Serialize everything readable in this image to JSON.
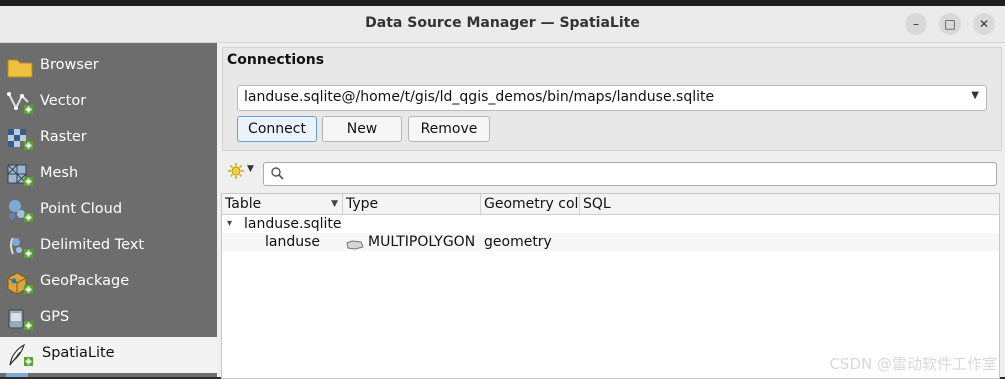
{
  "window": {
    "title": "Data Source Manager — SpatiaLite",
    "minimize_label": "–",
    "maximize_label": "□",
    "close_label": "✕"
  },
  "sidebar": {
    "items": [
      {
        "label": "Browser",
        "icon": "folder-icon"
      },
      {
        "label": "Vector",
        "icon": "vector-layer-icon"
      },
      {
        "label": "Raster",
        "icon": "raster-layer-icon"
      },
      {
        "label": "Mesh",
        "icon": "mesh-layer-icon"
      },
      {
        "label": "Point Cloud",
        "icon": "point-cloud-icon"
      },
      {
        "label": "Delimited Text",
        "icon": "delimited-text-icon"
      },
      {
        "label": "GeoPackage",
        "icon": "geopackage-icon"
      },
      {
        "label": "GPS",
        "icon": "gps-icon"
      },
      {
        "label": "SpatiaLite",
        "icon": "spatialite-feather-icon",
        "active": true
      }
    ]
  },
  "connections": {
    "title": "Connections",
    "selected": "landuse.sqlite@/home/t/gis/ld_qgis_demos/bin/maps/landuse.sqlite",
    "connect_label": "Connect",
    "new_label": "New",
    "remove_label": "Remove"
  },
  "filter": {
    "search_value": "",
    "search_placeholder": ""
  },
  "table": {
    "headers": [
      "Table",
      "Type",
      "Geometry colu",
      "SQL"
    ],
    "group": {
      "label": "landuse.sqlite",
      "expander": "▾"
    },
    "rows": [
      {
        "table": "landuse",
        "type": "MULTIPOLYGON",
        "geometry": "geometry",
        "sql": ""
      }
    ]
  },
  "watermark": "CSDN @雷动软件工作室",
  "colors": {
    "sidebar_bg": "#6d6d6d",
    "sidebar_active_bg": "#f3f3f3",
    "dialog_bg": "#efefef",
    "focus_border": "#6d9ccf"
  }
}
